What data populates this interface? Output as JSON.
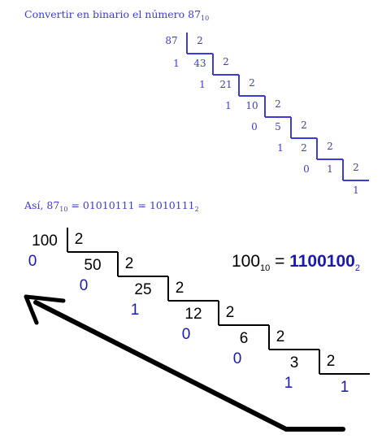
{
  "top": {
    "title_text": "Convertir en binario el número 87",
    "title_subscript": "10",
    "number": "87",
    "divisor": "2",
    "quotients": [
      "43",
      "21",
      "10",
      "5",
      "2",
      "1"
    ],
    "remainders": [
      "1",
      "1",
      "1",
      "0",
      "1",
      "0"
    ],
    "last_quotient_remainder": "1",
    "result_prefix": "Así, 87",
    "result_prefix_subscript": "10",
    "result_middle": " = 01010111 = 1010111",
    "result_subscript": "2",
    "color": "#3b3bd9"
  },
  "bottom": {
    "number": "100",
    "divisor": "2",
    "quotients": [
      "50",
      "25",
      "12",
      "6",
      "3"
    ],
    "remainders": [
      "0",
      "0",
      "1",
      "0",
      "0",
      "1"
    ],
    "last_quotient_remainder": "1",
    "equation_left": "100",
    "equation_left_subscript": "10",
    "equation_equals": " = ",
    "equation_right": "1100100",
    "equation_right_subscript": "2",
    "text_color": "#000000",
    "remainder_color": "#1a1ab3",
    "arrow_color": "#000000"
  }
}
